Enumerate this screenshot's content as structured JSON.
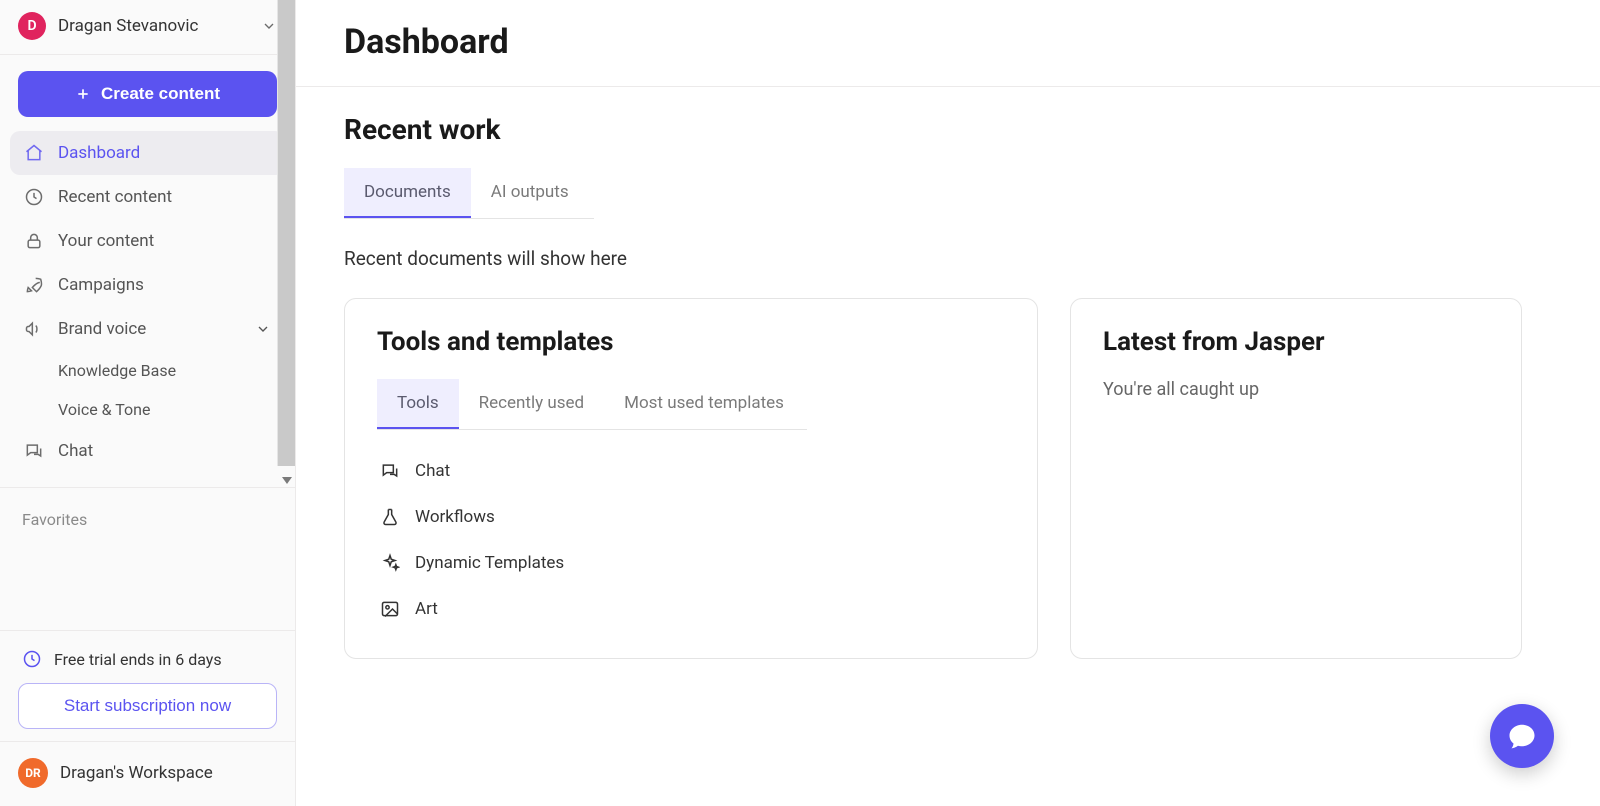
{
  "user": {
    "initial": "D",
    "name": "Dragan Stevanovic"
  },
  "sidebar": {
    "create_label": "Create content",
    "items": [
      {
        "label": "Dashboard"
      },
      {
        "label": "Recent content"
      },
      {
        "label": "Your content"
      },
      {
        "label": "Campaigns"
      },
      {
        "label": "Brand voice"
      },
      {
        "label": "Chat"
      }
    ],
    "brand_sub": [
      {
        "label": "Knowledge Base"
      },
      {
        "label": "Voice & Tone"
      }
    ],
    "favorites_label": "Favorites",
    "trial_text": "Free trial ends in 6 days",
    "subscribe_label": "Start subscription now",
    "workspace": {
      "initials": "DR",
      "name": "Dragan's Workspace"
    }
  },
  "main": {
    "title": "Dashboard",
    "recent": {
      "heading": "Recent work",
      "tabs": [
        {
          "label": "Documents"
        },
        {
          "label": "AI outputs"
        }
      ],
      "empty": "Recent documents will show here"
    },
    "tools": {
      "heading": "Tools and templates",
      "tabs": [
        {
          "label": "Tools"
        },
        {
          "label": "Recently used"
        },
        {
          "label": "Most used templates"
        }
      ],
      "items": [
        {
          "label": "Chat"
        },
        {
          "label": "Workflows"
        },
        {
          "label": "Dynamic Templates"
        },
        {
          "label": "Art"
        }
      ]
    },
    "news": {
      "heading": "Latest from Jasper",
      "body": "You're all caught up"
    }
  }
}
